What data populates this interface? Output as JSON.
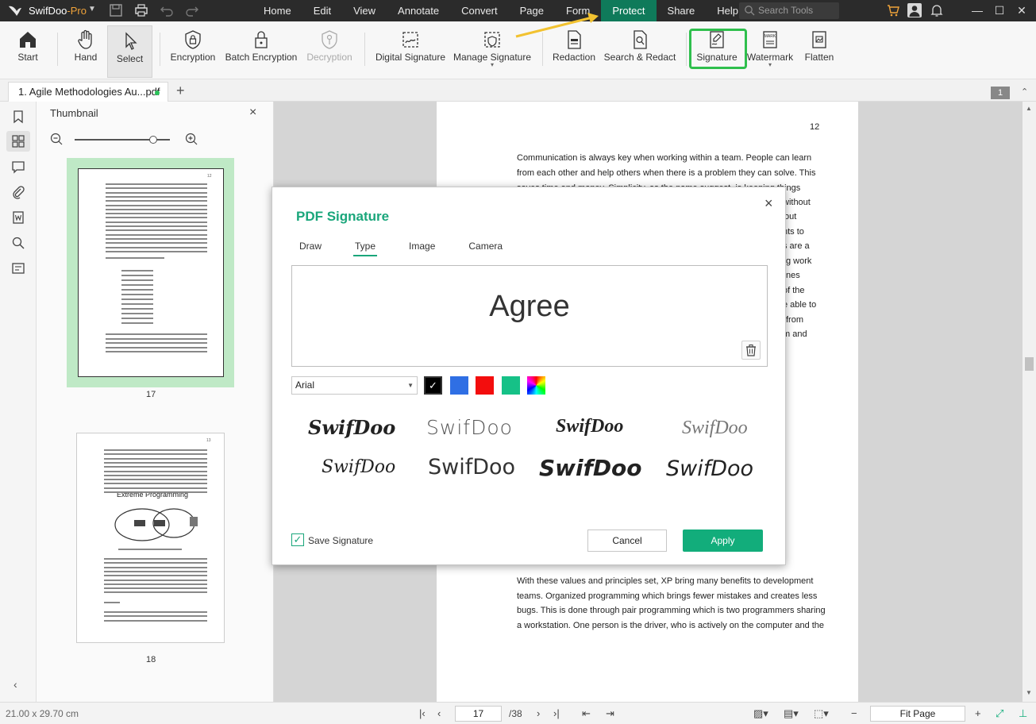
{
  "app": {
    "name": "SwifDoo",
    "edition": "-Pro"
  },
  "menus": [
    "Home",
    "Edit",
    "View",
    "Annotate",
    "Convert",
    "Page",
    "Form",
    "Protect",
    "Share",
    "Help"
  ],
  "active_menu": "Protect",
  "search": {
    "placeholder": "Search Tools"
  },
  "toolbar": {
    "start": "Start",
    "hand": "Hand",
    "select": "Select",
    "encryption": "Encryption",
    "batch_encryption": "Batch Encryption",
    "decryption": "Decryption",
    "digital_signature": "Digital Signature",
    "manage_signature": "Manage Signature",
    "redaction": "Redaction",
    "search_redact": "Search & Redact",
    "signature": "Signature",
    "watermark": "Watermark",
    "flatten": "Flatten",
    "mark_icon_text": "MARK"
  },
  "tab": {
    "title": "1. Agile Methodologies Au...pdf",
    "add": "+",
    "page_badge": "1"
  },
  "thumbnail_panel": {
    "title": "Thumbnail",
    "close": "×",
    "pages": [
      {
        "number": "17",
        "page_label": "12"
      },
      {
        "number": "18",
        "page_label": "13"
      }
    ],
    "thumb2_heading": "Extreme Programming"
  },
  "document": {
    "page_number": "12",
    "lines_top": [
      "Communication is always key when working within a team. People can learn",
      "from each other and help others when there is a problem they can solve. This",
      "saves time and money. Simplicity, as the name suggest, is keeping things"
    ],
    "fragments_right": [
      "without",
      "out",
      "nts to",
      "s are a",
      "g work",
      "nes",
      "of the",
      "e able to",
      "from",
      "m and"
    ],
    "lines_bottom": [
      "With these values and principles set, XP bring many benefits to development",
      "teams. Organized programming which brings fewer mistakes and creates less",
      "bugs. This is done through pair programming which is two programmers sharing",
      "a workstation. One person is the driver, who is actively on the computer and the"
    ]
  },
  "dialog": {
    "title": "PDF Signature",
    "tabs": [
      "Draw",
      "Type",
      "Image",
      "Camera"
    ],
    "active_tab": "Type",
    "signature_text": "Agree",
    "font": "Arial",
    "colors": [
      "#000000",
      "#2f6fe4",
      "#f30d0d",
      "#16c187"
    ],
    "styles": [
      "SwifDoo",
      "SwifDoo",
      "SwifDoo",
      "SwifDoo",
      "SwifDoo",
      "SwifDoo",
      "SwifDoo",
      "SwifDoo"
    ],
    "save_signature": "Save Signature",
    "save_checked": true,
    "cancel": "Cancel",
    "apply": "Apply",
    "close": "×"
  },
  "statusbar": {
    "dimensions": "21.00 x 29.70 cm",
    "current_page": "17",
    "total_pages": "/38",
    "fit_mode": "Fit Page"
  },
  "accent_color": "#12ad7b",
  "highlight_color": "#2fbf4d"
}
